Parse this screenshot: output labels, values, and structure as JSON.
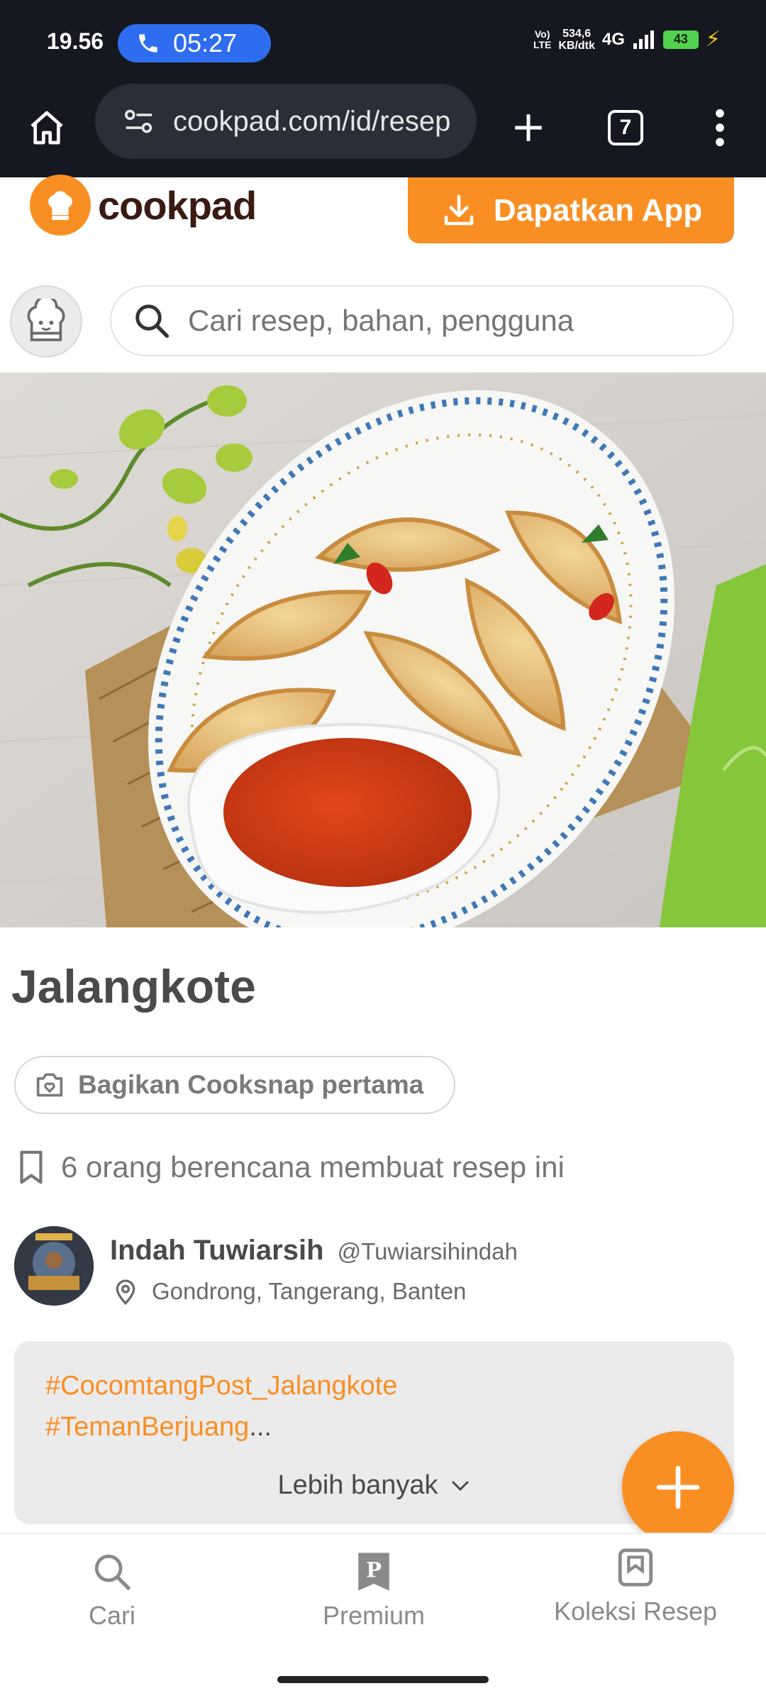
{
  "status_bar": {
    "time": "19.56",
    "call_duration": "05:27",
    "volte": "Vo)\nLTE",
    "net_speed_value": "534,6",
    "net_speed_unit": "KB/dtk",
    "network": "4G",
    "battery": "43"
  },
  "browser": {
    "url": "cookpad.com/id/resep",
    "tab_count": "7"
  },
  "header": {
    "brand": "cookpad",
    "get_app_label": "Dapatkan App",
    "search_placeholder": "Cari resep, bahan, pengguna"
  },
  "recipe": {
    "title": "Jalangkote",
    "cooksnap_label": "Bagikan Cooksnap pertama",
    "plan_text": "6 orang berencana membuat resep ini",
    "author": {
      "name": "Indah Tuwiarsih",
      "handle": "@Tuwiarsihindah",
      "location": "Gondrong, Tangerang, Banten"
    },
    "description": {
      "hashtag_1": "#CocomtangPost_Jalangkote",
      "hashtag_2": "#TemanBerjuang",
      "ellipsis": "...",
      "more_label": "Lebih banyak"
    }
  },
  "bottom_nav": {
    "items": [
      {
        "label": "Cari",
        "icon": "search-icon"
      },
      {
        "label": "Premium",
        "icon": "premium-icon"
      },
      {
        "label": "Koleksi Resep",
        "icon": "collection-icon"
      }
    ]
  },
  "colors": {
    "brand_orange": "#f98f23",
    "status_bar_bg": "#151821",
    "call_pill": "#2f6df0"
  }
}
